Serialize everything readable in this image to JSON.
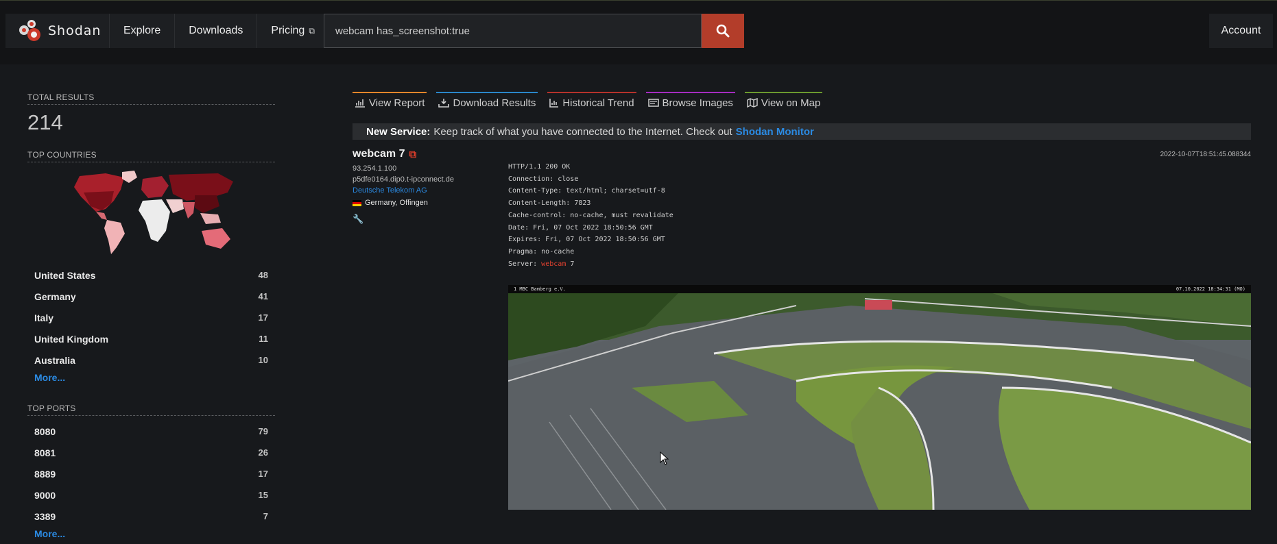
{
  "header": {
    "brand": "Shodan",
    "nav": [
      {
        "label": "Explore"
      },
      {
        "label": "Downloads"
      },
      {
        "label": "Pricing",
        "icon": "external-link-icon"
      }
    ],
    "search": {
      "value": "webcam has_screenshot:true",
      "button_icon": "search-icon"
    },
    "account_label": "Account",
    "colors": {
      "accent": "#b33d2a",
      "link": "#2b8ae2",
      "background": "#17191c"
    }
  },
  "sidebar": {
    "total_title": "TOTAL RESULTS",
    "total": "214",
    "countries_title": "TOP COUNTRIES",
    "countries": [
      {
        "name": "United States",
        "count": "48"
      },
      {
        "name": "Germany",
        "count": "41"
      },
      {
        "name": "Italy",
        "count": "17"
      },
      {
        "name": "United Kingdom",
        "count": "11"
      },
      {
        "name": "Australia",
        "count": "10"
      }
    ],
    "countries_more": "More...",
    "ports_title": "TOP PORTS",
    "ports": [
      {
        "name": "8080",
        "count": "79"
      },
      {
        "name": "8081",
        "count": "26"
      },
      {
        "name": "8889",
        "count": "17"
      },
      {
        "name": "9000",
        "count": "15"
      },
      {
        "name": "3389",
        "count": "7"
      }
    ],
    "ports_more": "More..."
  },
  "main": {
    "tabs": [
      {
        "label": "View Report",
        "icon": "report-icon",
        "color": "#e3852a"
      },
      {
        "label": "Download Results",
        "icon": "download-icon",
        "color": "#2a86c9"
      },
      {
        "label": "Historical Trend",
        "icon": "chart-icon",
        "color": "#b6322b"
      },
      {
        "label": "Browse Images",
        "icon": "images-icon",
        "color": "#a52cc0"
      },
      {
        "label": "View on Map",
        "icon": "map-icon",
        "color": "#6b9a2e"
      }
    ],
    "banner": {
      "bold": "New Service:",
      "text": "Keep track of what you have connected to the Internet. Check out",
      "link": "Shodan Monitor"
    },
    "result": {
      "title": "webcam 7",
      "timestamp": "2022-10-07T18:51:45.088344",
      "ip": "93.254.1.100",
      "hostname": "p5dfe0164.dip0.t-ipconnect.de",
      "org": "Deutsche Telekom AG",
      "location": "Germany, Offingen",
      "http": [
        "HTTP/1.1 200 OK",
        "Connection: close",
        "Content-Type: text/html; charset=utf-8",
        "Content-Length: 7823",
        "Cache-control: no-cache, must revalidate",
        "Date: Fri, 07 Oct 2022 18:50:56 GMT",
        "Expires: Fri, 07 Oct 2022 18:50:56 GMT",
        "Pragma: no-cache"
      ],
      "server_prefix": "Server: ",
      "server_highlight": "webcam",
      "server_suffix": " 7",
      "screenshot_caption_left": "1 MBC Bamberg e.V.",
      "screenshot_caption_right": "07.10.2022 18:34:31 (MO)"
    }
  }
}
